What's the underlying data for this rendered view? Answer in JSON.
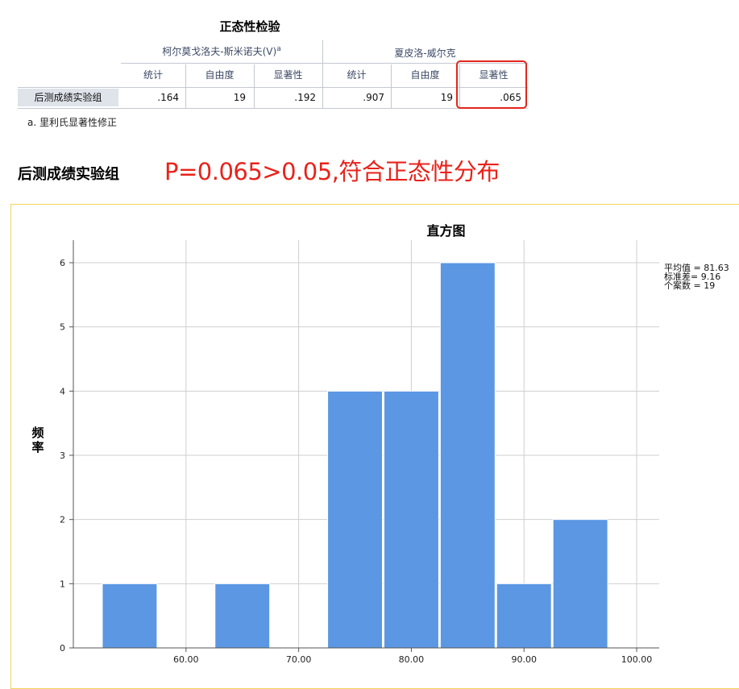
{
  "normality_table": {
    "title": "正态性检验",
    "group_ks": "柯尔莫戈洛夫-斯米诺夫(V)",
    "group_ks_sup": "a",
    "group_sw": "夏皮洛-威尔克",
    "col_headers": [
      "统计",
      "自由度",
      "显著性",
      "统计",
      "自由度",
      "显著性"
    ],
    "row": {
      "label": "后测成绩实验组",
      "values": [
        ".164",
        "19",
        ".192",
        ".907",
        "19",
        ".065"
      ]
    },
    "footnote": "a. 里利氏显著性修正"
  },
  "section_label": "后测成绩实验组",
  "annotation": "P=0.065>0.05,符合正态性分布",
  "highlight_color": "#e2261c",
  "stats": {
    "mean": "平均值 = 81.63",
    "sd": "标准差= 9.16",
    "n": "个案数 = 19"
  },
  "chart_data": {
    "type": "bar",
    "title": "直方图",
    "xlabel": "",
    "ylabel": "频率",
    "bar_color": "#5b97e3",
    "xlim": [
      50,
      102
    ],
    "ylim": [
      0,
      6
    ],
    "x_ticks": [
      "60.00",
      "70.00",
      "80.00",
      "90.00",
      "100.00"
    ],
    "x_tick_values": [
      60,
      70,
      80,
      90,
      100
    ],
    "y_ticks": [
      "0",
      "1",
      "2",
      "3",
      "4",
      "5",
      "6"
    ],
    "bins": [
      {
        "from": 52.5,
        "to": 57.5,
        "value": 1
      },
      {
        "from": 57.5,
        "to": 62.5,
        "value": 0
      },
      {
        "from": 62.5,
        "to": 67.5,
        "value": 1
      },
      {
        "from": 67.5,
        "to": 72.5,
        "value": 0
      },
      {
        "from": 72.5,
        "to": 77.5,
        "value": 4
      },
      {
        "from": 77.5,
        "to": 82.5,
        "value": 4
      },
      {
        "from": 82.5,
        "to": 87.5,
        "value": 6
      },
      {
        "from": 87.5,
        "to": 92.5,
        "value": 1
      },
      {
        "from": 92.5,
        "to": 97.5,
        "value": 2
      }
    ]
  }
}
